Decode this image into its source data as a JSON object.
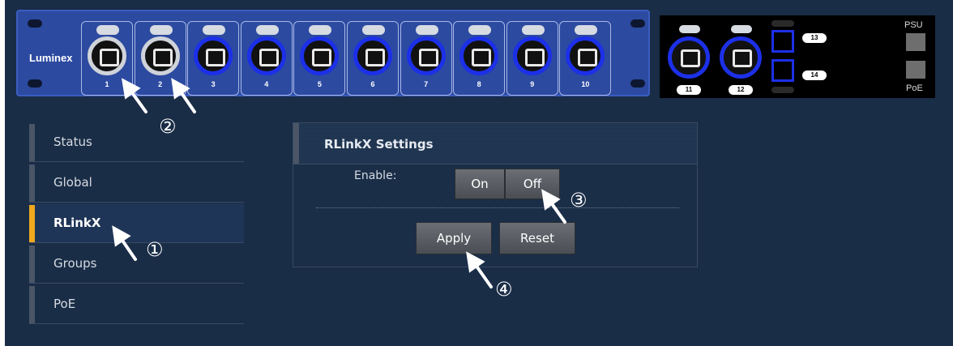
{
  "switch": {
    "brand": "Luminex",
    "ports": [
      {
        "num": "1",
        "ring": "white"
      },
      {
        "num": "2",
        "ring": "white"
      },
      {
        "num": "3",
        "ring": "blue"
      },
      {
        "num": "4",
        "ring": "blue"
      },
      {
        "num": "5",
        "ring": "blue"
      },
      {
        "num": "6",
        "ring": "blue"
      },
      {
        "num": "7",
        "ring": "blue"
      },
      {
        "num": "8",
        "ring": "blue"
      },
      {
        "num": "9",
        "ring": "blue"
      },
      {
        "num": "10",
        "ring": "blue"
      }
    ]
  },
  "module": {
    "ports": [
      "11",
      "12"
    ],
    "sfp": [
      "13",
      "14"
    ],
    "psu_label": "PSU",
    "poe_label": "PoE"
  },
  "sidebar": {
    "items": [
      {
        "label": "Status",
        "active": false
      },
      {
        "label": "Global",
        "active": false
      },
      {
        "label": "RLinkX",
        "active": true
      },
      {
        "label": "Groups",
        "active": false
      },
      {
        "label": "PoE",
        "active": false
      }
    ]
  },
  "panel": {
    "title": "RLinkX Settings",
    "enable_label": "Enable:",
    "on_label": "On",
    "off_label": "Off",
    "apply_label": "Apply",
    "reset_label": "Reset"
  },
  "callouts": {
    "c1": "①",
    "c2": "②",
    "c3": "③",
    "c4": "④"
  },
  "colors": {
    "background": "#1a2d47",
    "accent": "#f0a81e",
    "port_blue": "#1c30e8"
  }
}
